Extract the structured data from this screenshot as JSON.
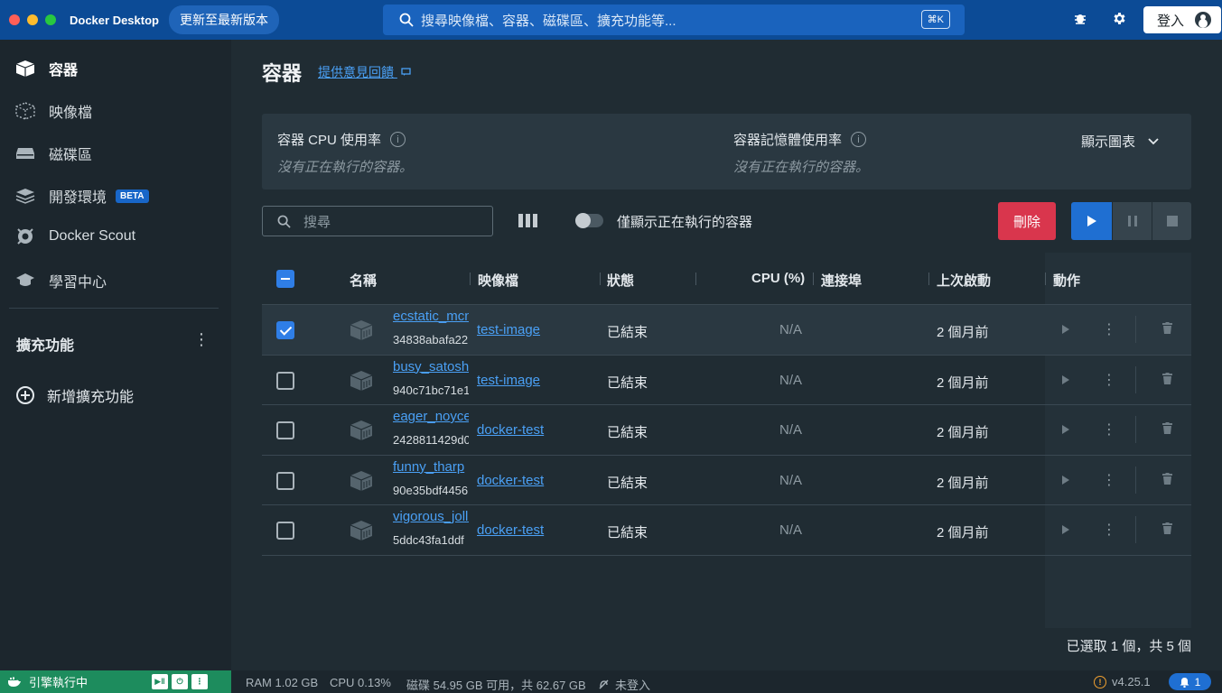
{
  "window": {
    "app_title": "Docker Desktop",
    "update_label": "更新至最新版本",
    "search_placeholder": "搜尋映像檔、容器、磁碟區、擴充功能等...",
    "search_shortcut": "⌘K",
    "signin_label": "登入"
  },
  "sidebar": {
    "items": [
      {
        "label": "容器",
        "icon": "container-icon",
        "active": true
      },
      {
        "label": "映像檔",
        "icon": "image-icon"
      },
      {
        "label": "磁碟區",
        "icon": "volume-icon"
      },
      {
        "label": "開發環境",
        "icon": "dev-env-icon",
        "badge": "BETA"
      },
      {
        "label": "Docker Scout",
        "icon": "scout-icon"
      },
      {
        "label": "學習中心",
        "icon": "learning-icon"
      }
    ],
    "extensions_title": "擴充功能",
    "add_extension_label": "新增擴充功能"
  },
  "main": {
    "title": "容器",
    "feedback_label": "提供意見回饋",
    "cpu_usage_label": "容器 CPU 使用率",
    "cpu_usage_value": "沒有正在執行的容器。",
    "mem_usage_label": "容器記憶體使用率",
    "mem_usage_value": "沒有正在執行的容器。",
    "show_charts_label": "顯示圖表",
    "search_placeholder": "搜尋",
    "running_only_label": "僅顯示正在執行的容器",
    "running_only_enabled": false,
    "delete_label": "刪除",
    "columns": [
      "名稱",
      "映像檔",
      "狀態",
      "CPU (%)",
      "連接埠",
      "上次啟動",
      "動作"
    ],
    "rows": [
      {
        "name": "ecstatic_mcnulty",
        "id": "34838abafa22",
        "image": "test-image",
        "status": "已結束",
        "cpu": "N/A",
        "last_started": "2 個月前",
        "selected": true
      },
      {
        "name": "busy_satoshi",
        "id": "940c71bc71e1",
        "image": "test-image",
        "status": "已結束",
        "cpu": "N/A",
        "last_started": "2 個月前",
        "selected": false
      },
      {
        "name": "eager_noyce",
        "id": "2428811429d0",
        "image": "docker-test",
        "status": "已結束",
        "cpu": "N/A",
        "last_started": "2 個月前",
        "selected": false
      },
      {
        "name": "funny_tharp",
        "id": "90e35bdf4456",
        "image": "docker-test",
        "status": "已結束",
        "cpu": "N/A",
        "last_started": "2 個月前",
        "selected": false
      },
      {
        "name": "vigorous_jolliot",
        "id": "5ddc43fa1ddf",
        "image": "docker-test",
        "status": "已結束",
        "cpu": "N/A",
        "last_started": "2 個月前",
        "selected": false
      }
    ],
    "selection_summary": "已選取 1 個，共 5 個"
  },
  "statusbar": {
    "engine_label": "引擎執行中",
    "ram": "RAM 1.02 GB",
    "cpu": "CPU 0.13%",
    "disk": "磁碟 54.95 GB 可用，共 62.67 GB",
    "signin_status": "未登入",
    "version": "v4.25.1",
    "notifications": "1"
  },
  "colors": {
    "titlebar": "#0c4b96",
    "accent": "#1f6fd2",
    "delete": "#d9364d",
    "engine_running": "#1d8c5d",
    "link": "#4aa0f5"
  }
}
